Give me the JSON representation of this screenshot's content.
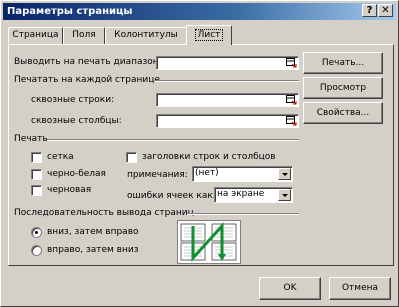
{
  "window": {
    "title": "Параметры страницы",
    "help_glyph": "?",
    "close_glyph": "✕"
  },
  "tabs": [
    {
      "label": "Страница",
      "active": false
    },
    {
      "label": "Поля",
      "active": false
    },
    {
      "label": "Колонтитулы",
      "active": false
    },
    {
      "label": "Лист",
      "active": true
    }
  ],
  "sheet": {
    "print_area_label": "Выводить на печать диапазон:",
    "print_area_value": "",
    "titles_group_label": "Печатать на каждой странице",
    "rows_label": "сквозные строки:",
    "rows_value": "",
    "cols_label": "сквозные столбцы:",
    "cols_value": "",
    "print_group_label": "Печать",
    "gridlines_label": "сетка",
    "gridlines_checked": false,
    "bw_label": "черно-белая",
    "bw_checked": false,
    "draft_label": "черновая",
    "draft_checked": false,
    "headings_label": "заголовки строк и столбцов",
    "headings_checked": false,
    "comments_label": "примечания:",
    "comments_value": "(нет)",
    "errors_label": "ошибки ячеек как:",
    "errors_value": "на экране",
    "order_group_label": "Последовательность вывода страниц",
    "order_down_label": "вниз, затем вправо",
    "order_down_selected": true,
    "order_over_label": "вправо, затем вниз",
    "order_over_selected": false
  },
  "side_buttons": {
    "print": "Печать...",
    "preview": "Просмотр",
    "options": "Свойства..."
  },
  "footer": {
    "ok": "OK",
    "cancel": "Отмена"
  },
  "colors": {
    "face": "#d4d0c8",
    "title_start": "#0a246a",
    "title_end": "#a6caf0",
    "arrow_green": "#109030"
  }
}
